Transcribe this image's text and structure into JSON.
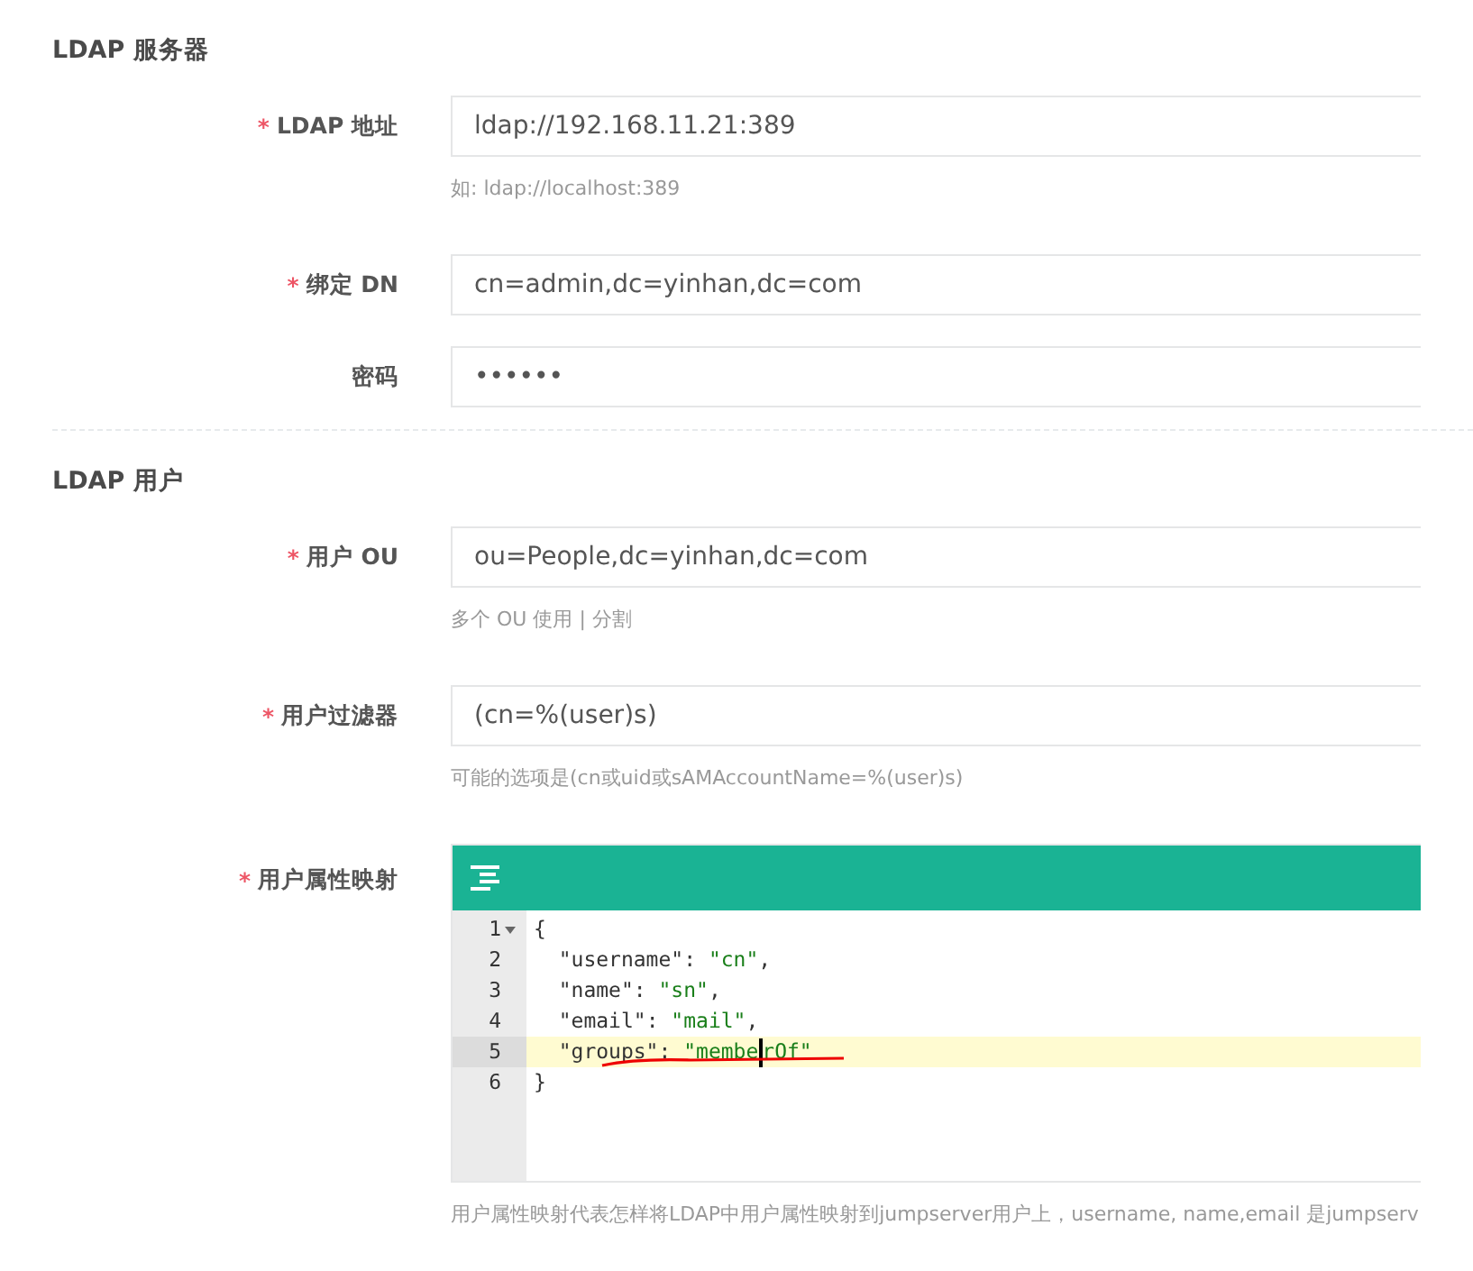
{
  "required_mark": "*",
  "sections": [
    {
      "title": "LDAP 服务器",
      "fields": [
        {
          "kind": "text",
          "label": "LDAP 地址",
          "required": true,
          "value": "ldap://192.168.11.21:389",
          "help": "如: ldap://localhost:389"
        },
        {
          "kind": "text",
          "label": "绑定 DN",
          "required": true,
          "value": "cn=admin,dc=yinhan,dc=com"
        },
        {
          "kind": "text",
          "label": "密码",
          "required": false,
          "value": "••••••"
        }
      ]
    },
    {
      "title": "LDAP 用户",
      "fields": [
        {
          "kind": "text",
          "label": "用户 OU",
          "required": true,
          "value": "ou=People,dc=yinhan,dc=com",
          "help": "多个 OU 使用 | 分割"
        },
        {
          "kind": "text",
          "label": "用户过滤器",
          "required": true,
          "value": "(cn=%(user)s)",
          "help": "可能的选项是(cn或uid或sAMAccountName=%(user)s)"
        },
        {
          "kind": "code",
          "label": "用户属性映射",
          "required": true,
          "help": "用户属性映射代表怎样将LDAP中用户属性映射到jumpserver用户上，username, name,email 是jumpserv",
          "lines": [
            {
              "number": "1",
              "active": false,
              "foldable": true,
              "tokens": [
                {
                  "kind": "punct",
                  "text": "{"
                }
              ]
            },
            {
              "number": "2",
              "active": false,
              "foldable": false,
              "tokens": [
                {
                  "kind": "key",
                  "text": "  \"username\""
                },
                {
                  "kind": "punct",
                  "text": ": "
                },
                {
                  "kind": "string",
                  "text": "\"cn\""
                },
                {
                  "kind": "punct",
                  "text": ","
                }
              ]
            },
            {
              "number": "3",
              "active": false,
              "foldable": false,
              "tokens": [
                {
                  "kind": "key",
                  "text": "  \"name\""
                },
                {
                  "kind": "punct",
                  "text": ": "
                },
                {
                  "kind": "string",
                  "text": "\"sn\""
                },
                {
                  "kind": "punct",
                  "text": ","
                }
              ]
            },
            {
              "number": "4",
              "active": false,
              "foldable": false,
              "tokens": [
                {
                  "kind": "key",
                  "text": "  \"email\""
                },
                {
                  "kind": "punct",
                  "text": ": "
                },
                {
                  "kind": "string",
                  "text": "\"mail\""
                },
                {
                  "kind": "punct",
                  "text": ","
                }
              ]
            },
            {
              "number": "5",
              "active": true,
              "foldable": false,
              "tokens": [
                {
                  "kind": "key",
                  "text": "  \"groups\""
                },
                {
                  "kind": "punct",
                  "text": ": "
                },
                {
                  "kind": "string",
                  "text": "\"membe"
                },
                {
                  "kind": "cursor"
                },
                {
                  "kind": "string",
                  "text": "rOf\""
                }
              ]
            },
            {
              "number": "6",
              "active": false,
              "foldable": false,
              "tokens": [
                {
                  "kind": "punct",
                  "text": "}"
                }
              ]
            }
          ]
        }
      ]
    }
  ]
}
